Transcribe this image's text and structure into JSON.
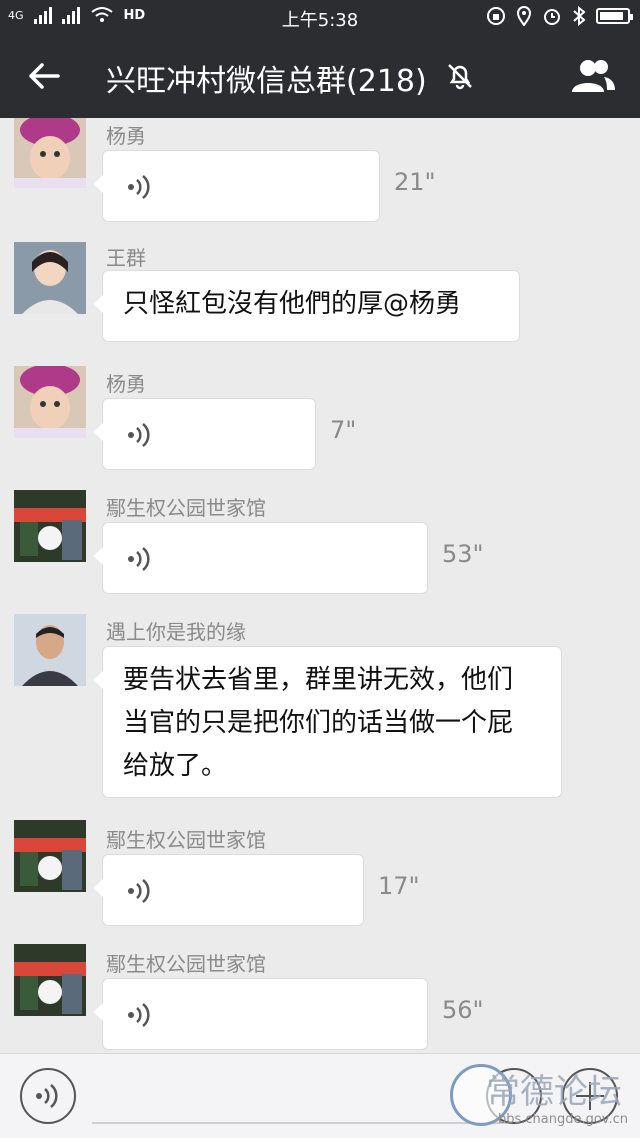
{
  "status_bar": {
    "network_1": "4G",
    "network_2": "HD",
    "time": "上午5:38",
    "battery_percent": 90
  },
  "header": {
    "title": "兴旺冲村微信总群(218)",
    "back_icon": "arrow-left-icon",
    "mute_icon": "bell-off-icon",
    "members_icon": "group-icon"
  },
  "messages": [
    {
      "sender": "杨勇",
      "type": "voice",
      "duration": "21\""
    },
    {
      "sender": "王群",
      "type": "text",
      "text": "只怪紅包沒有他們的厚@杨勇"
    },
    {
      "sender": "杨勇",
      "type": "voice",
      "duration": "7\""
    },
    {
      "sender": "鄢生权公园世家馆",
      "type": "voice",
      "duration": "53\""
    },
    {
      "sender": "遇上你是我的缘",
      "type": "text",
      "lines": [
        "要告状去省里，群里讲无效，他们",
        "当官的只是把你们的话当做一个屁",
        "给放了。"
      ]
    },
    {
      "sender": "鄢生权公园世家馆",
      "type": "voice",
      "duration": "17\""
    },
    {
      "sender": "鄢生权公园世家馆",
      "type": "voice",
      "duration": "56\""
    }
  ],
  "input_bar": {
    "voice_icon": "voice-icon",
    "emoji_icon": "emoji-icon",
    "plus_icon": "plus-icon"
  },
  "watermark": {
    "text": "常德论坛",
    "url": "bbs.changde.gov.cn"
  },
  "colors": {
    "header_bg": "#2b2d31",
    "chat_bg": "#ebebeb",
    "bubble_bg": "#ffffff",
    "meta_text": "#8a8a8a"
  }
}
